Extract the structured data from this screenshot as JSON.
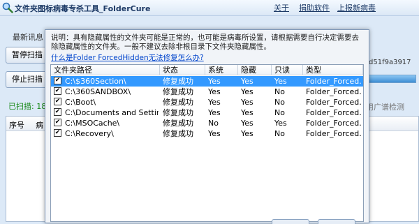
{
  "app": {
    "title": "文件夹图标病毒专杀工具_FolderCure",
    "links": [
      "关于",
      "捐助软件",
      "上报新病毒"
    ]
  },
  "main": {
    "latest_tab": "最新讯息",
    "pause_button": "暂停扫描",
    "stop_button": "停止扫描",
    "scanned_label": "已扫描: 18",
    "hash_fragment": "d51f9a3917",
    "broad_check": "用广谱检测",
    "list_headers": [
      "序号",
      "病"
    ]
  },
  "dialog": {
    "note": "说明：具有隐藏属性的文件夹可能是正常的，也可能是病毒所设置，请根据需要自行决定需要去除隐藏属性的文件夹。一般不建议去除非根目录下文件夹隐藏属性。",
    "help_link": "什么是Folder ForcedHidden无法修复怎么办?",
    "headers": [
      "文件夹路径",
      "状态",
      "系统",
      "隐藏",
      "只读",
      "类型"
    ],
    "rows": [
      {
        "path": "C:\\$360Section\\",
        "status": "修复成功",
        "system": "Yes",
        "hidden": "Yes",
        "readonly": "Yes",
        "type": "Folder_Forced..."
      },
      {
        "path": "C:\\360SANDBOX\\",
        "status": "修复成功",
        "system": "Yes",
        "hidden": "Yes",
        "readonly": "No",
        "type": "Folder_Forced..."
      },
      {
        "path": "C:\\Boot\\",
        "status": "修复成功",
        "system": "Yes",
        "hidden": "Yes",
        "readonly": "No",
        "type": "Folder_Forced..."
      },
      {
        "path": "C:\\Documents and Settings\\",
        "status": "修复成功",
        "system": "Yes",
        "hidden": "Yes",
        "readonly": "No",
        "type": "Folder_Forced..."
      },
      {
        "path": "C:\\MSOCache\\",
        "status": "修复成功",
        "system": "No",
        "hidden": "Yes",
        "readonly": "Yes",
        "type": "Folder_Forced..."
      },
      {
        "path": "C:\\Recovery\\",
        "status": "修复成功",
        "system": "Yes",
        "hidden": "Yes",
        "readonly": "No",
        "type": "Folder_Forced..."
      }
    ]
  }
}
